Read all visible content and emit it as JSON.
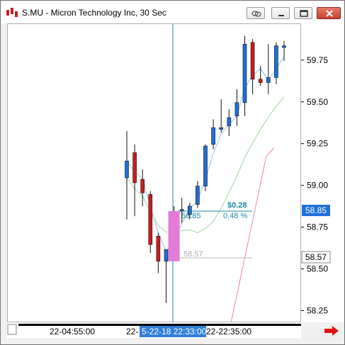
{
  "window": {
    "title": "S.MU - Micron Technology Inc, 30 Sec"
  },
  "colors": {
    "up_candle": "#1f6fd6",
    "down_candle": "#c81e1e",
    "crosshair": "#1a8aa6",
    "ma_fast": "#a8cdea",
    "ma_slow": "#b7dcb5",
    "ma_third": "#f28bb8",
    "highlight_bar": "#e27ad6",
    "axis_selected": "#1f6fd6"
  },
  "price_axis": {
    "ticks": [
      "59.75",
      "59.50",
      "59.25",
      "59.00",
      "58.75",
      "58.50",
      "58.25"
    ],
    "cursor_label": "58.85",
    "ref_label": "58.57"
  },
  "time_axis": {
    "left_label": "22-04:55:00",
    "prefix_label": "22-",
    "selected_label": "5-22-18 22:33:00",
    "right_label": "22-22:35:00"
  },
  "measure": {
    "change": "$0.28",
    "start_price": "58.85",
    "percent": "0.48 %",
    "ref_price": "58.57"
  },
  "chart_data": {
    "type": "candlestick",
    "title": "S.MU - Micron Technology Inc, 30 Sec",
    "ylim": [
      58.18,
      59.97
    ],
    "candles": [
      {
        "o": 59.05,
        "h": 59.33,
        "l": 58.8,
        "c": 59.15
      },
      {
        "o": 59.2,
        "h": 59.25,
        "l": 58.82,
        "c": 59.02
      },
      {
        "o": 59.04,
        "h": 59.1,
        "l": 58.88,
        "c": 58.96
      },
      {
        "o": 58.95,
        "h": 58.97,
        "l": 58.6,
        "c": 58.65
      },
      {
        "o": 58.7,
        "h": 58.72,
        "l": 58.48,
        "c": 58.55
      },
      {
        "o": 58.55,
        "h": 58.62,
        "l": 58.3,
        "c": 58.62
      },
      {
        "o": 58.55,
        "h": 58.88,
        "l": 58.55,
        "c": 58.85,
        "highlight": true
      },
      {
        "o": 58.85,
        "h": 58.93,
        "l": 58.78,
        "c": 58.86
      },
      {
        "o": 58.83,
        "h": 58.9,
        "l": 58.8,
        "c": 58.88
      },
      {
        "o": 58.89,
        "h": 59.03,
        "l": 58.87,
        "c": 59.0
      },
      {
        "o": 59.0,
        "h": 59.25,
        "l": 58.97,
        "c": 59.24
      },
      {
        "o": 59.25,
        "h": 59.4,
        "l": 59.22,
        "c": 59.35
      },
      {
        "o": 59.34,
        "h": 59.52,
        "l": 59.32,
        "c": 59.35
      },
      {
        "o": 59.36,
        "h": 59.46,
        "l": 59.3,
        "c": 59.41
      },
      {
        "o": 59.42,
        "h": 59.58,
        "l": 59.36,
        "c": 59.5
      },
      {
        "o": 59.5,
        "h": 59.9,
        "l": 59.42,
        "c": 59.85
      },
      {
        "o": 59.86,
        "h": 59.88,
        "l": 59.55,
        "c": 59.64
      },
      {
        "o": 59.64,
        "h": 59.72,
        "l": 59.6,
        "c": 59.62
      },
      {
        "o": 59.62,
        "h": 59.85,
        "l": 59.55,
        "c": 59.65
      },
      {
        "o": 59.65,
        "h": 59.86,
        "l": 59.61,
        "c": 59.84
      },
      {
        "o": 59.83,
        "h": 59.87,
        "l": 59.75,
        "c": 59.84
      }
    ]
  }
}
